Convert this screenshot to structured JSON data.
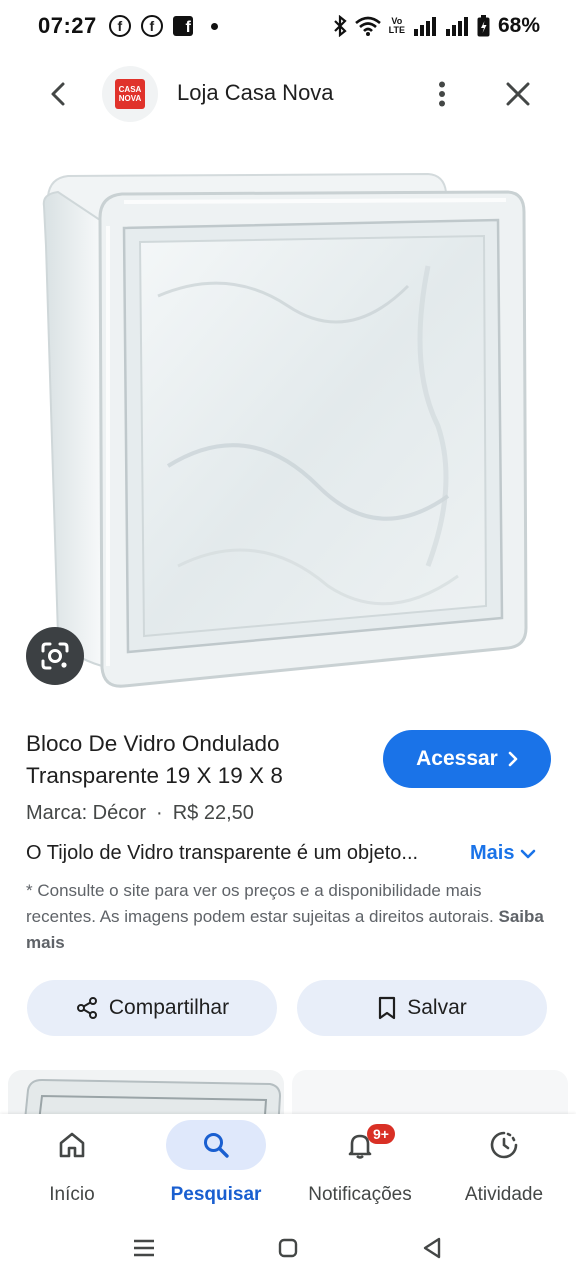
{
  "status_bar": {
    "time": "07:27",
    "battery": "68%",
    "volte": "VoLTE"
  },
  "header": {
    "site_name": "Loja Casa Nova",
    "logo_text_1": "CASA",
    "logo_text_2": "NOVA"
  },
  "product": {
    "title": "Bloco De Vidro Ondulado Transparente 19 X 19 X 8",
    "brand": "Marca: Décor",
    "price": "R$ 22,50",
    "description": "O Tijolo de Vidro transparente é um objeto...",
    "more_label": "Mais",
    "disclaimer": "* Consulte o site para ver os preços e a disponibilidade mais recentes. As imagens podem estar sujeitas a direitos autorais.",
    "learn_more": "Saiba mais"
  },
  "actions": {
    "visit_label": "Acessar",
    "share_label": "Compartilhar",
    "save_label": "Salvar"
  },
  "bottom_nav": {
    "items": [
      {
        "label": "Início",
        "icon": "home-icon"
      },
      {
        "label": "Pesquisar",
        "icon": "search-icon"
      },
      {
        "label": "Notificações",
        "icon": "bell-icon",
        "badge": "9+"
      },
      {
        "label": "Atividade",
        "icon": "activity-icon"
      }
    ],
    "active_index": 1
  },
  "colors": {
    "accent": "#1a73e8",
    "chip_bg": "#e8eef9",
    "badge": "#d93025"
  }
}
